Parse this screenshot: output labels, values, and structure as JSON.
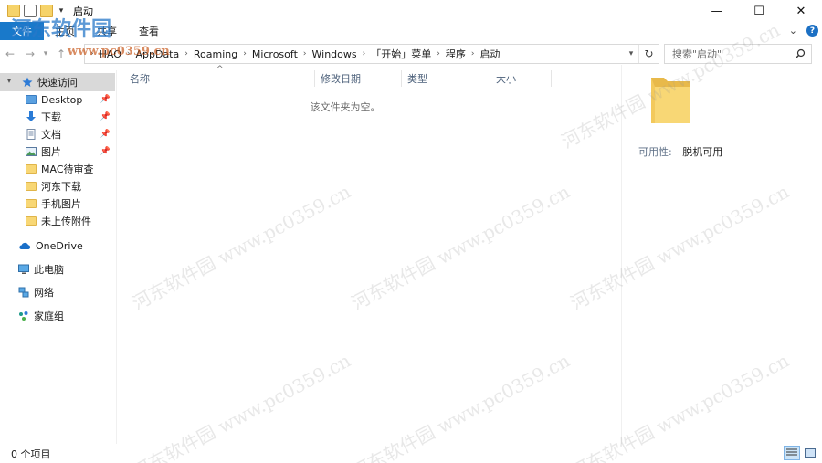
{
  "window": {
    "title": "启动",
    "controls": {
      "minimize": "—",
      "maximize": "☐",
      "close": "✕"
    }
  },
  "ribbon": {
    "file_tab": "文件",
    "tabs": [
      "主页",
      "共享",
      "查看"
    ],
    "help": "?"
  },
  "address": {
    "crumbs": [
      "HAO",
      "AppData",
      "Roaming",
      "Microsoft",
      "Windows",
      "「开始」菜单",
      "程序",
      "启动"
    ]
  },
  "search": {
    "placeholder": "搜索\"启动\""
  },
  "sidebar": {
    "quick_access": "快速访问",
    "items": [
      {
        "label": "Desktop",
        "icon": "desktop-folder-icon",
        "pinned": true
      },
      {
        "label": "下载",
        "icon": "download-arrow-icon",
        "pinned": true
      },
      {
        "label": "文档",
        "icon": "document-icon",
        "pinned": true
      },
      {
        "label": "图片",
        "icon": "picture-icon",
        "pinned": true
      },
      {
        "label": "MAC待审查",
        "icon": "folder-icon",
        "pinned": false
      },
      {
        "label": "河东下载",
        "icon": "folder-icon",
        "pinned": false
      },
      {
        "label": "手机图片",
        "icon": "folder-icon",
        "pinned": false
      },
      {
        "label": "未上传附件",
        "icon": "folder-icon",
        "pinned": false
      }
    ],
    "onedrive": "OneDrive",
    "this_pc": "此电脑",
    "network": "网络",
    "homegroup": "家庭组"
  },
  "columns": {
    "name": "名称",
    "modified": "修改日期",
    "type": "类型",
    "size": "大小"
  },
  "content": {
    "empty_message": "该文件夹为空。"
  },
  "preview": {
    "availability_label": "可用性:",
    "availability_value": "脱机可用"
  },
  "status": {
    "item_count": "0 个项目"
  },
  "watermark": {
    "logo": "河东软件园",
    "url": "www.pc0359.cn",
    "diag": "河东软件园 www.pc0359.cn"
  },
  "colors": {
    "file_tab": "#1979ca",
    "selected": "#d9d9d9",
    "folder": "#f8d775",
    "column_header": "#4c607a"
  }
}
